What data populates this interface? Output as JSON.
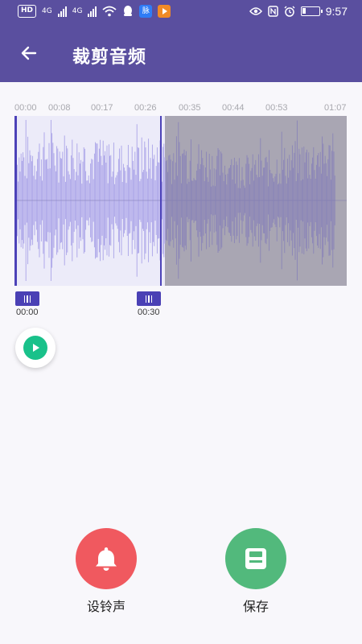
{
  "status_bar": {
    "hd_badge": "HD",
    "net_label_1": "4G",
    "net_label_2": "4G",
    "app_badge": "脉",
    "time": "9:57",
    "icons": [
      "hd-badge-icon",
      "signal-icon",
      "signal-icon",
      "wifi-icon",
      "qq-icon",
      "app-badge-icon",
      "video-app-icon",
      "eye-icon",
      "nfc-icon",
      "alarm-icon",
      "battery-icon"
    ],
    "battery_level": 0.15
  },
  "app_bar": {
    "title": "裁剪音频",
    "back_icon": "arrow-left-icon"
  },
  "timeline": {
    "ticks": [
      "00:00",
      "00:08",
      "00:17",
      "00:26",
      "00:35",
      "00:44",
      "00:53",
      "01:07"
    ]
  },
  "selection": {
    "start_label": "00:00",
    "end_label": "00:30",
    "start_fraction": 0.0,
    "end_fraction": 0.45
  },
  "colors": {
    "primary": "#5a4f9f",
    "selection_bg": "#ecebf9",
    "selection_wave": "#aaa3e8",
    "selection_border": "#4c42b8",
    "unselected_bg": "#a9a6b3",
    "unselected_wave": "#8a84b8",
    "play_green": "#19c18a",
    "ringtone_red": "#f0595f",
    "save_green": "#52b97c"
  },
  "player": {
    "play_icon": "play-icon"
  },
  "actions": {
    "ringtone": {
      "label": "设铃声",
      "icon": "bell-icon",
      "color": "#f0595f"
    },
    "save": {
      "label": "保存",
      "icon": "floppy-disk-icon",
      "color": "#52b97c"
    }
  }
}
